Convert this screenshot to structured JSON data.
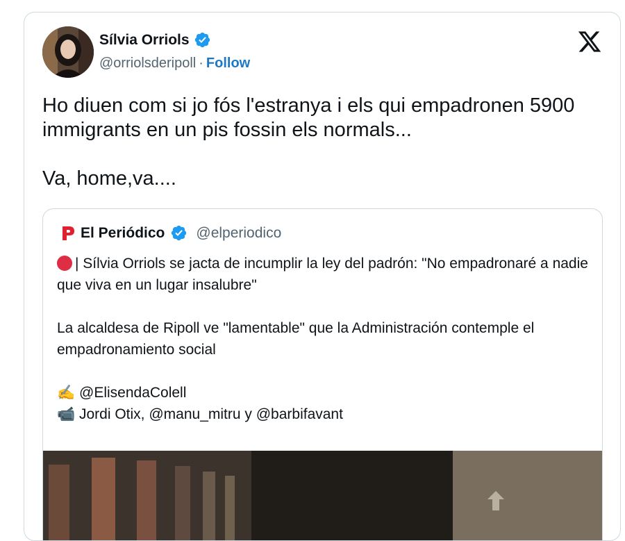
{
  "author": {
    "name": "Sílvia Orriols",
    "handle": "@orriolsderipoll",
    "separator": "·",
    "follow_label": "Follow",
    "verified_icon": "verified-badge-icon",
    "verified_color": "#1d9bf0"
  },
  "platform_icon": "x-logo-icon",
  "tweet": {
    "text": "Ho diuen com si jo fós l'estranya i els qui empadronen 5900 immigrants en  un pis fossin els normals...\n\nVa, home,va...."
  },
  "quote": {
    "name": "El Periódico",
    "handle": "@elperiodico",
    "logo_color": "#e0202f",
    "line1": "| Sílvia Orriols se jacta de incumplir la ley del padrón: \"No empadronaré a nadie que viva en un lugar insalubre\"",
    "line2": "La alcaldesa de Ripoll ve \"lamentable\" que la Administración contemple el empadronamiento social",
    "credit_writer": "@ElisendaColell",
    "credit_video": "Jordi Otix, @manu_mitru y @barbifavant",
    "writer_emoji": "✍️",
    "video_emoji": "📹"
  },
  "colors": {
    "text": "#0f1419",
    "secondary": "#536471",
    "link": "#1d78c5",
    "border": "#cfd9de"
  }
}
